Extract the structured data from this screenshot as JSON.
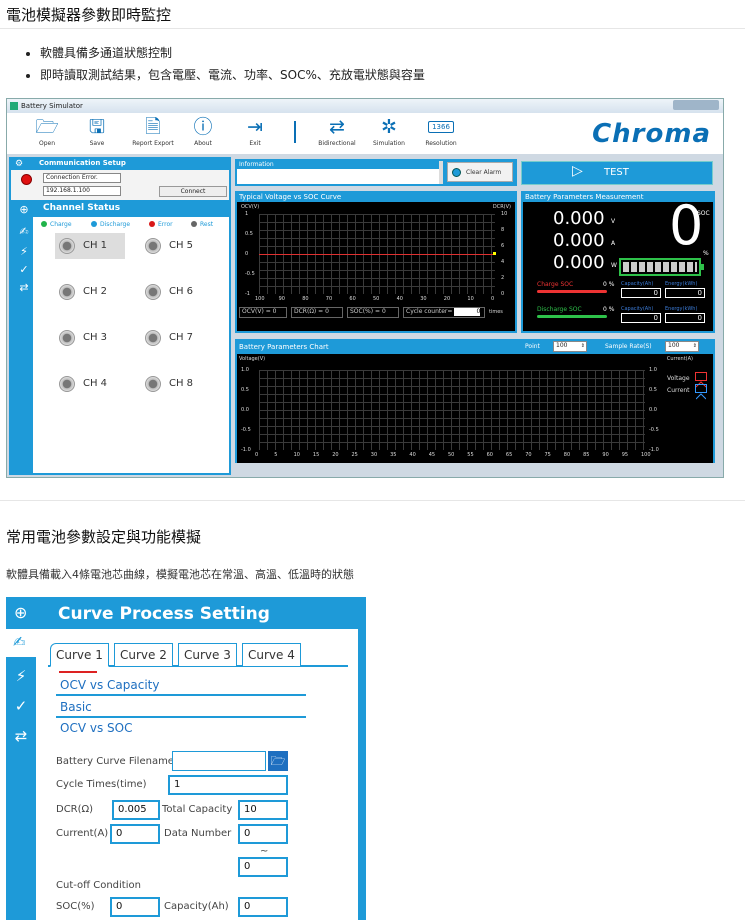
{
  "section1": {
    "title": "電池模擬器參數即時監控",
    "bullets": [
      "軟體具備多通道狀態控制",
      "即時讀取測試結果，包含電壓、電流、功率、SOC%、充放電狀態與容量"
    ]
  },
  "window": {
    "title": "Battery Simulator",
    "toolbar": [
      "Open",
      "Save",
      "Report Export",
      "About",
      "Exit",
      "Bidirectional",
      "Simulation",
      "Resolution"
    ],
    "resolution_value": "1366",
    "logo": "Chroma"
  },
  "comm": {
    "title": "Communication Setup",
    "status": "Connection Error.",
    "ip": "192.168.1.100",
    "connect": "Connect"
  },
  "channel": {
    "title": "Channel Status",
    "legend": [
      "Charge",
      "Discharge",
      "Error",
      "Rest"
    ],
    "legend_colors": [
      "#21b34a",
      "#1e9ad8",
      "#d81818",
      "#666666"
    ],
    "items": [
      "CH 1",
      "CH 5",
      "CH 2",
      "CH 6",
      "CH 3",
      "CH 7",
      "CH 4",
      "CH 8"
    ]
  },
  "info": {
    "title": "Information",
    "clear_alarm": "Clear Alarm",
    "test": "TEST"
  },
  "vsoc": {
    "title": "Typical Voltage vs SOC Curve",
    "yleft": "OCV(V)",
    "yright": "DCR(V)",
    "yleft_ticks": [
      "1",
      "0.5",
      "0",
      "-0.5",
      "-1"
    ],
    "yright_ticks": [
      "10",
      "8",
      "6",
      "4",
      "2",
      "0"
    ],
    "xticks": [
      "100",
      "90",
      "80",
      "70",
      "60",
      "50",
      "40",
      "30",
      "20",
      "10",
      "0"
    ],
    "ocv": "OCV(V) = 0",
    "dcr": "DCR(Ω) = 0",
    "soc": "SOC(%) = 0",
    "cycle": "Cycle counter=",
    "cycle_val": "0",
    "times": "times"
  },
  "meas": {
    "title": "Battery Parameters Measurement",
    "v": "0.000",
    "v_unit": "V",
    "a": "0.000",
    "a_unit": "A",
    "w": "0.000",
    "w_unit": "W",
    "soc_big": "0",
    "soc_label": "SOC",
    "pct": "%",
    "charge_soc": "Charge SOC",
    "discharge_soc": "Discharge SOC",
    "charge_pct": "0 %",
    "discharge_pct": "0 %",
    "cap_label": "Capacity(Ah)",
    "energy_label": "Energy(kWh)",
    "cap1": "0",
    "en1": "0",
    "cap2": "0",
    "en2": "0"
  },
  "chart": {
    "title": "Battery Parameters Chart",
    "point_label": "Point",
    "point_val": "100",
    "rate_label": "Sample Rate(S)",
    "rate_val": "100",
    "yleft": "Voltage(V)",
    "yright": "Current(A)",
    "yticks": [
      "1.0",
      "0.5",
      "0.0",
      "-0.5",
      "-1.0"
    ],
    "xticks": [
      "0",
      "5",
      "10",
      "15",
      "20",
      "25",
      "30",
      "35",
      "40",
      "45",
      "50",
      "55",
      "60",
      "65",
      "70",
      "75",
      "80",
      "85",
      "90",
      "95",
      "100"
    ],
    "legend_voltage": "Voltage",
    "legend_current": "Current"
  },
  "section2": {
    "title": "常用電池參數設定與功能模擬",
    "desc": "軟體具備載入4條電池芯曲線，模擬電池芯在常溫、高溫、低溫時的狀態"
  },
  "cps": {
    "title": "Curve Process Setting",
    "tabs": [
      "Curve 1",
      "Curve 2",
      "Curve 3",
      "Curve 4"
    ],
    "links": [
      "OCV vs Capacity",
      "Basic",
      "OCV vs SOC"
    ],
    "filename_label": "Battery Curve Filename",
    "cycle_label": "Cycle Times(time)",
    "cycle_val": "1",
    "dcr_label": "DCR(Ω)",
    "dcr_val": "0.005",
    "totcap_label": "Total Capacity",
    "totcap_val": "10",
    "current_label": "Current(A)",
    "current_val": "0",
    "datanum_label": "Data Number",
    "datanum_val1": "0",
    "tilde": "~",
    "datanum_val2": "0",
    "cutoff_label": "Cut-off Condition",
    "soc_label": "SOC(%)",
    "soc_val": "0",
    "cap_label": "Capacity(Ah)",
    "cap_val": "0"
  }
}
